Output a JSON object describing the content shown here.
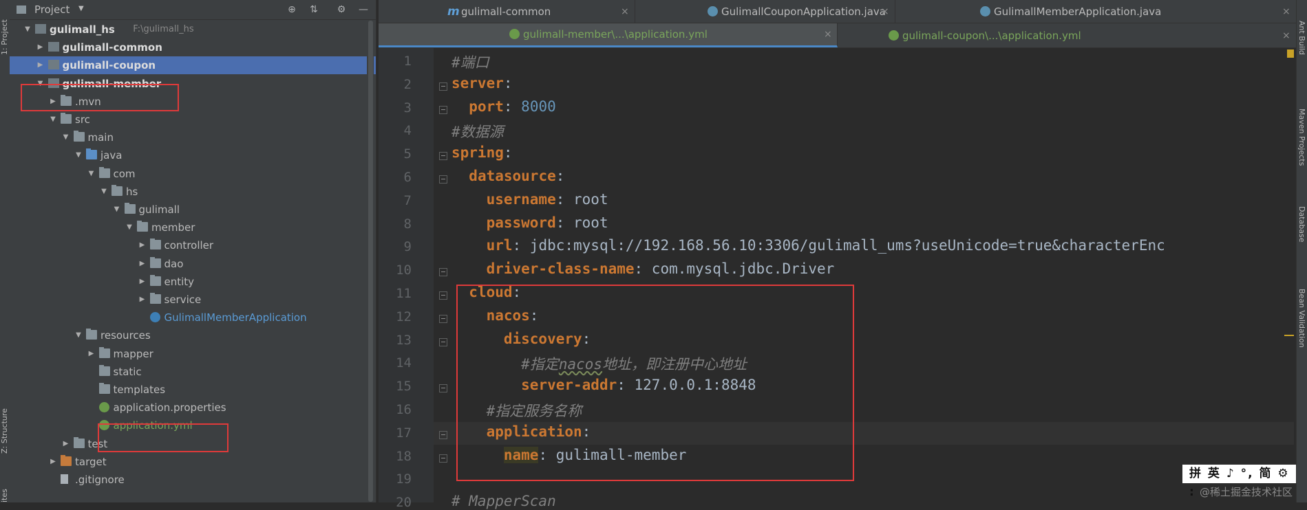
{
  "left_strip": {
    "project_label": "1: Project",
    "structure_label": "Z: Structure",
    "favorites_label": "ites"
  },
  "project_panel": {
    "title": "Project",
    "dropdown_glyph": "▼",
    "header_icons": [
      "target-icon",
      "collapse-icon",
      "gear-icon",
      "hide-icon"
    ]
  },
  "tree": [
    {
      "label": "gulimall_hs",
      "path": "F:\\gulimall_hs",
      "depth": 0,
      "arrow": "down",
      "icon": "module",
      "bold": true
    },
    {
      "label": "gulimall-common",
      "depth": 1,
      "arrow": "right",
      "icon": "module",
      "bold": true
    },
    {
      "label": "gulimall-coupon",
      "depth": 1,
      "arrow": "right",
      "icon": "module",
      "bold": true,
      "selected": true
    },
    {
      "label": "gulimall-member",
      "depth": 1,
      "arrow": "down",
      "icon": "module",
      "bold": true
    },
    {
      "label": ".mvn",
      "depth": 2,
      "arrow": "right",
      "icon": "folder"
    },
    {
      "label": "src",
      "depth": 2,
      "arrow": "down",
      "icon": "folder"
    },
    {
      "label": "main",
      "depth": 3,
      "arrow": "down",
      "icon": "folder"
    },
    {
      "label": "java",
      "depth": 4,
      "arrow": "down",
      "icon": "folder-blue"
    },
    {
      "label": "com",
      "depth": 5,
      "arrow": "down",
      "icon": "package"
    },
    {
      "label": "hs",
      "depth": 6,
      "arrow": "down",
      "icon": "package"
    },
    {
      "label": "gulimall",
      "depth": 7,
      "arrow": "down",
      "icon": "package"
    },
    {
      "label": "member",
      "depth": 8,
      "arrow": "down",
      "icon": "package"
    },
    {
      "label": "controller",
      "depth": 9,
      "arrow": "right",
      "icon": "package"
    },
    {
      "label": "dao",
      "depth": 9,
      "arrow": "right",
      "icon": "package"
    },
    {
      "label": "entity",
      "depth": 9,
      "arrow": "right",
      "icon": "package"
    },
    {
      "label": "service",
      "depth": 9,
      "arrow": "right",
      "icon": "package"
    },
    {
      "label": "GulimallMemberApplication",
      "depth": 9,
      "arrow": "none",
      "icon": "spring-java",
      "style": "blue"
    },
    {
      "label": "resources",
      "depth": 4,
      "arrow": "down",
      "icon": "folder-res"
    },
    {
      "label": "mapper",
      "depth": 5,
      "arrow": "right",
      "icon": "folder"
    },
    {
      "label": "static",
      "depth": 5,
      "arrow": "none",
      "icon": "folder"
    },
    {
      "label": "templates",
      "depth": 5,
      "arrow": "none",
      "icon": "folder"
    },
    {
      "label": "application.properties",
      "depth": 5,
      "arrow": "none",
      "icon": "spring"
    },
    {
      "label": "application.yml",
      "depth": 5,
      "arrow": "none",
      "icon": "spring",
      "style": "green"
    },
    {
      "label": "test",
      "depth": 3,
      "arrow": "right",
      "icon": "folder"
    },
    {
      "label": "target",
      "depth": 2,
      "arrow": "right",
      "icon": "folder-orange"
    },
    {
      "label": ".gitignore",
      "depth": 2,
      "arrow": "none",
      "icon": "file"
    }
  ],
  "tabs_row1": [
    {
      "label": "gulimall-common",
      "icon": "maven-m-icon"
    },
    {
      "label": "GulimallCouponApplication.java",
      "icon": "spring-java-icon"
    },
    {
      "label": "GulimallMemberApplication.java",
      "icon": "spring-java-icon"
    }
  ],
  "tabs_row2": [
    {
      "label": "gulimall-member\\...\\application.yml",
      "icon": "spring-yml-icon",
      "active": true
    },
    {
      "label": "gulimall-coupon\\...\\application.yml",
      "icon": "spring-yml-icon"
    }
  ],
  "close_glyph": "×",
  "editor": {
    "lines": [
      {
        "n": "1",
        "parts": [
          [
            "c",
            "#端口"
          ]
        ]
      },
      {
        "n": "2",
        "parts": [
          [
            "k",
            "server"
          ],
          [
            "plain",
            ":"
          ]
        ]
      },
      {
        "n": "3",
        "parts": [
          [
            "plain",
            "  "
          ],
          [
            "k",
            "port"
          ],
          [
            "plain",
            ": "
          ],
          [
            "v",
            "8000"
          ]
        ]
      },
      {
        "n": "4",
        "parts": [
          [
            "c",
            "#数据源"
          ]
        ]
      },
      {
        "n": "5",
        "parts": [
          [
            "k",
            "spring"
          ],
          [
            "plain",
            ":"
          ]
        ]
      },
      {
        "n": "6",
        "parts": [
          [
            "plain",
            "  "
          ],
          [
            "k",
            "datasource"
          ],
          [
            "plain",
            ":"
          ]
        ]
      },
      {
        "n": "7",
        "parts": [
          [
            "plain",
            "    "
          ],
          [
            "k",
            "username"
          ],
          [
            "plain",
            ": root"
          ]
        ]
      },
      {
        "n": "8",
        "parts": [
          [
            "plain",
            "    "
          ],
          [
            "k",
            "password"
          ],
          [
            "plain",
            ": root"
          ]
        ]
      },
      {
        "n": "9",
        "parts": [
          [
            "plain",
            "    "
          ],
          [
            "k",
            "url"
          ],
          [
            "plain",
            ": jdbc:mysql://192.168.56.10:3306/gulimall_ums?useUnicode=true&characterEnc"
          ]
        ]
      },
      {
        "n": "10",
        "parts": [
          [
            "plain",
            "    "
          ],
          [
            "k",
            "driver-class-name"
          ],
          [
            "plain",
            ": com.mysql.jdbc.Driver"
          ]
        ]
      },
      {
        "n": "11",
        "parts": [
          [
            "plain",
            "  "
          ],
          [
            "k",
            "cloud"
          ],
          [
            "plain",
            ":"
          ]
        ]
      },
      {
        "n": "12",
        "parts": [
          [
            "plain",
            "    "
          ],
          [
            "k",
            "nacos"
          ],
          [
            "plain",
            ":"
          ]
        ]
      },
      {
        "n": "13",
        "parts": [
          [
            "plain",
            "      "
          ],
          [
            "k",
            "discovery"
          ],
          [
            "plain",
            ":"
          ]
        ]
      },
      {
        "n": "14",
        "parts": [
          [
            "plain",
            "        "
          ],
          [
            "c",
            "#指定"
          ],
          [
            "cu",
            "nacos"
          ],
          [
            "c",
            "地址，即注册中心地址"
          ]
        ]
      },
      {
        "n": "15",
        "parts": [
          [
            "plain",
            "        "
          ],
          [
            "k",
            "server-addr"
          ],
          [
            "plain",
            ": 127.0.0.1:8848"
          ]
        ]
      },
      {
        "n": "16",
        "parts": [
          [
            "plain",
            "    "
          ],
          [
            "c",
            "#指定服务名称"
          ]
        ]
      },
      {
        "n": "17",
        "parts": [
          [
            "plain",
            "    "
          ],
          [
            "k",
            "application"
          ],
          [
            "plain",
            ":"
          ]
        ]
      },
      {
        "n": "18",
        "parts": [
          [
            "plain",
            "      "
          ],
          [
            "kh",
            "name"
          ],
          [
            "plain",
            ": gulimall-member"
          ]
        ]
      },
      {
        "n": "19",
        "parts": []
      },
      {
        "n": "20",
        "parts": [
          [
            "c",
            "# MapperScan"
          ]
        ]
      }
    ]
  },
  "right_strip": {
    "ant_build": "Ant Build",
    "maven_projects": "Maven Projects",
    "database": "Database",
    "bean_validation": "Bean Validation"
  },
  "ime_bar": "拼 英 ♪ °, 简 ⚙ :",
  "watermark": "@稀土掘金技术社区",
  "colors": {
    "selection": "#4b6eaf",
    "highlight_box": "#e03a3a",
    "keyword": "#cc7832",
    "comment": "#808080",
    "number": "#6897bb"
  }
}
